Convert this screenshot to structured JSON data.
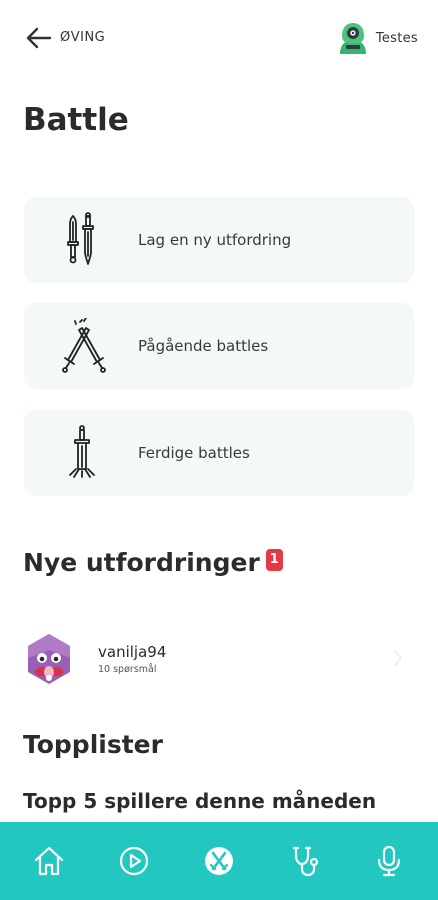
{
  "header": {
    "back_label": "ØVING",
    "profile_name": "Testes"
  },
  "page": {
    "title": "Battle"
  },
  "cards": [
    {
      "label": "Lag en ny utfordring",
      "icon": "swords-upright-icon"
    },
    {
      "label": "Pågående battles",
      "icon": "crossed-swords-icon"
    },
    {
      "label": "Ferdige battles",
      "icon": "sword-in-ground-icon"
    }
  ],
  "new_challenges": {
    "title": "Nye utfordringer",
    "badge_count": "1",
    "items": [
      {
        "name": "vanilja94",
        "subtitle": "10 spørsmål"
      }
    ]
  },
  "toplists": {
    "title": "Topplister",
    "subtitle": "Topp 5 spillere denne måneden"
  },
  "bottom_nav": {
    "items": [
      "home-icon",
      "play-icon",
      "battle-icon",
      "stethoscope-icon",
      "microphone-icon"
    ]
  },
  "colors": {
    "accent": "#22c8c0",
    "card_bg": "#f5f8f8",
    "badge": "#e53a45",
    "text": "#2b2b2b"
  }
}
